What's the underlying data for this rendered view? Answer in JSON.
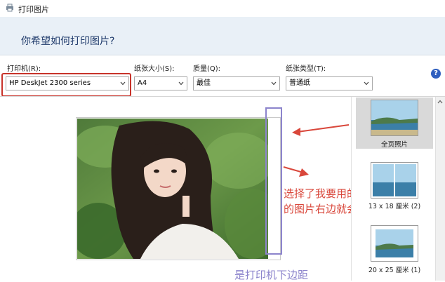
{
  "window": {
    "title": "打印图片"
  },
  "header": {
    "question": "你希望如何打印图片?"
  },
  "controls": {
    "printer": {
      "label": "打印机(R):",
      "value": "HP DeskJet 2300 series"
    },
    "paper_size": {
      "label": "纸张大小(S):",
      "value": "A4"
    },
    "quality": {
      "label": "质量(Q):",
      "value": "最佳"
    },
    "paper_type": {
      "label": "纸张类型(T):",
      "value": "普通纸"
    },
    "help_label": "?"
  },
  "layouts": [
    {
      "label": "全页照片",
      "selected": true
    },
    {
      "label": "13 x 18 厘米 (2)",
      "selected": false
    },
    {
      "label": "20 x 25 厘米 (1)",
      "selected": false
    }
  ],
  "annotations": {
    "main_note": "选择了我要用的打印机显示出来的图片右边就会空白一块",
    "bottom_note": "是打印机下边距"
  },
  "colors": {
    "annotation_red": "#d9473b",
    "annotation_purple": "#8c84cc",
    "header_band": "#e9f0f7"
  }
}
